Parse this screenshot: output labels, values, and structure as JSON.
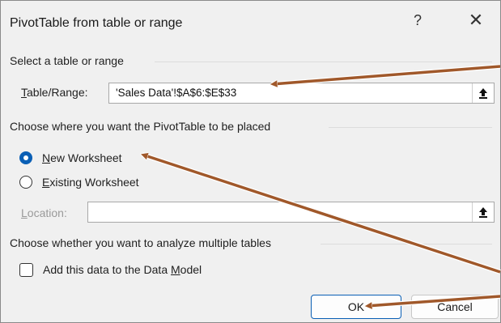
{
  "dialog": {
    "title": "PivotTable from table or range",
    "help_label": "?",
    "close_label": "✕"
  },
  "source_section": {
    "heading": "Select a table or range",
    "range_label_first": "T",
    "range_label_rest": "able/Range:",
    "range_value": "'Sales Data'!$A$6:$E$33"
  },
  "placement_section": {
    "heading": "Choose where you want the PivotTable to be placed",
    "new_worksheet_first": "N",
    "new_worksheet_rest": "ew Worksheet",
    "existing_worksheet_first": "E",
    "existing_worksheet_rest": "xisting Worksheet",
    "selected": "new",
    "location_label_first": "L",
    "location_label_rest": "ocation:",
    "location_value": ""
  },
  "model_section": {
    "heading": "Choose whether you want to analyze multiple tables",
    "checkbox_label_before": "Add this data to the Data ",
    "checkbox_label_mnemonic": "M",
    "checkbox_label_after": "odel",
    "checked": false
  },
  "buttons": {
    "ok_label": "OK",
    "cancel_label": "Cancel"
  },
  "colors": {
    "accent": "#0a5fb5",
    "annotation_arrow": "#a0582a"
  }
}
